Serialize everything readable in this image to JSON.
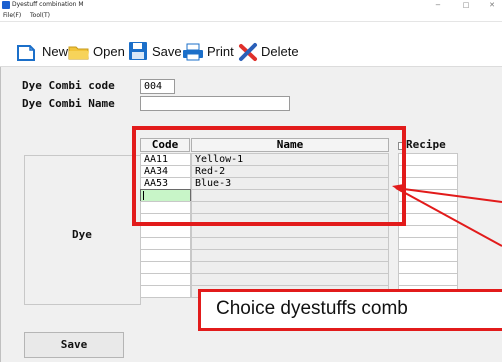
{
  "window": {
    "title": "Dyestuff combination M",
    "minimize": "−",
    "maximize": "□",
    "close": "✕"
  },
  "menu": [
    {
      "label": "File(F)"
    },
    {
      "label": "Tool(T)"
    }
  ],
  "toolbar": {
    "new_label": "New",
    "open_label": "Open",
    "save_label": "Save",
    "print_label": "Print",
    "delete_label": "Delete"
  },
  "form": {
    "code_label": "Dye Combi code",
    "code_value": "004",
    "name_label": "Dye Combi Name",
    "name_value": "",
    "recipe_label": "Recipe",
    "dye_label": "Dye",
    "save_button": "Save"
  },
  "grid": {
    "headers": {
      "code": "Code",
      "name": "Name"
    },
    "rows": [
      {
        "code": "AA11",
        "name": "Yellow-1"
      },
      {
        "code": "AA34",
        "name": "Red-2"
      },
      {
        "code": "AA53",
        "name": "Blue-3"
      }
    ]
  },
  "annotation": {
    "text": "Choice dyestuffs comb"
  },
  "colors": {
    "highlight": "#e21b1b",
    "active_cell": "#c8f5c8",
    "toolbar_icon_blue": "#1b6fc9"
  }
}
